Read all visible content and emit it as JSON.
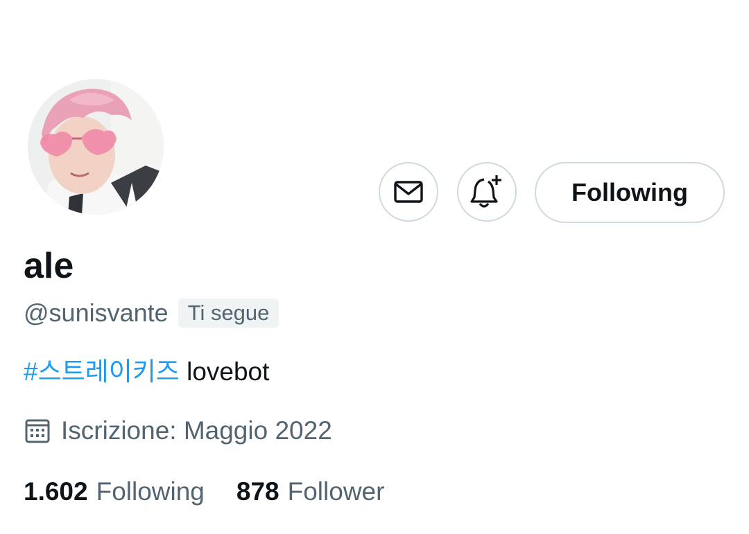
{
  "profile": {
    "display_name": "ale",
    "handle": "@sunisvante",
    "follows_you_badge": "Ti segue",
    "bio_hashtag": "#스트레이키즈",
    "bio_text": " lovebot",
    "joined": "Iscrizione: Maggio 2022"
  },
  "actions": {
    "message_icon": "mail-icon",
    "notify_icon": "bell-plus-icon",
    "follow_button_label": "Following"
  },
  "stats": {
    "following_count": "1.602",
    "following_label": "Following",
    "followers_count": "878",
    "followers_label": "Follower"
  },
  "colors": {
    "text_primary": "#0f1419",
    "text_secondary": "#536471",
    "border": "#cfd9de",
    "link": "#1d9bf0"
  }
}
